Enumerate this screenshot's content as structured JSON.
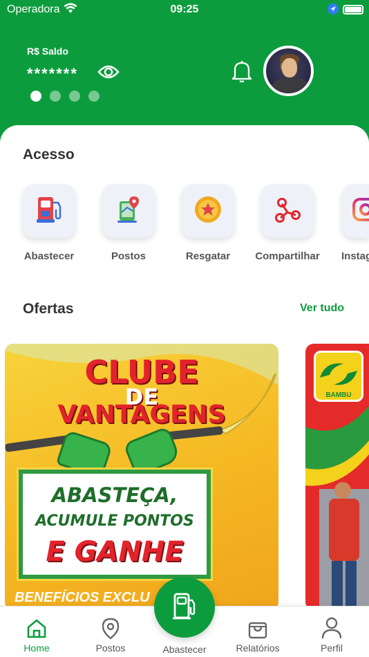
{
  "status_bar": {
    "carrier": "Operadora",
    "time": "09:25"
  },
  "header": {
    "saldo_label": "R$ Saldo",
    "saldo_value": "*******",
    "carousel_dots": 4,
    "active_dot": 0
  },
  "acesso": {
    "title": "Acesso",
    "items": [
      {
        "label": "Abastecer",
        "icon": "fuel-pump-icon"
      },
      {
        "label": "Postos",
        "icon": "map-pin-icon"
      },
      {
        "label": "Resgatar",
        "icon": "star-coin-icon"
      },
      {
        "label": "Compartilhar",
        "icon": "share-icon"
      },
      {
        "label": "Instag",
        "icon": "instagram-icon"
      }
    ]
  },
  "ofertas": {
    "title": "Ofertas",
    "ver_tudo": "Ver tudo",
    "banner1": {
      "line1": "CLUBE",
      "line2": "DE",
      "line3": "VANTAGENS",
      "slogan1": "ABASTEÇA,",
      "slogan2": "ACUMULE PONTOS",
      "slogan3": "E GANHE",
      "footer": "BENEFÍCIOS EXCLU"
    },
    "banner2": {
      "brand": "BAMBU"
    }
  },
  "bottom_nav": {
    "items": [
      {
        "label": "Home",
        "icon": "home-icon",
        "active": true
      },
      {
        "label": "Postos",
        "icon": "map-pin-icon"
      },
      {
        "label": "Abastecer",
        "icon": "fuel-pump-icon"
      },
      {
        "label": "Relatórios",
        "icon": "shopping-bag-icon"
      },
      {
        "label": "Perfil",
        "icon": "user-icon"
      }
    ]
  },
  "colors": {
    "brand": "#0c9c3d",
    "header": "#0c9c3d"
  }
}
